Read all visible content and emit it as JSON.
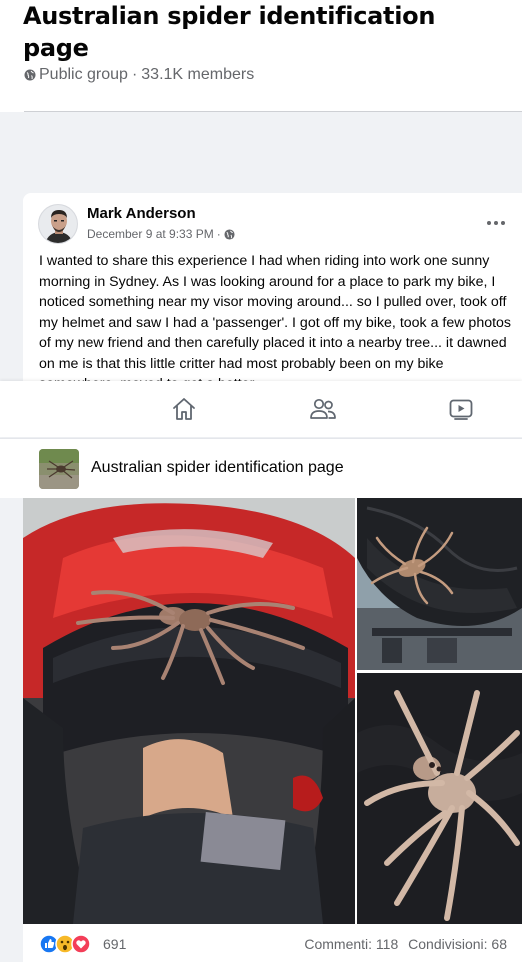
{
  "group": {
    "title": "Australian spider identification page",
    "privacy": "Public group",
    "separator": "·",
    "members": "33.1K members"
  },
  "post": {
    "author": "Mark Anderson",
    "date": "December 9 at 9:33 PM",
    "date_separator": "·",
    "text": "I wanted to share this experience I had when riding into work one sunny morning in Sydney. As I was looking around for a place to park my bike, I noticed something near my visor moving around... so I pulled over, took off my helmet and saw I had a 'passenger'. I got off my bike, took a few photos of my new friend and then carefully placed it into a nearby tree... it  dawned on me is that this little critter had most probably been on my bike somewhere, moved to get a better"
  },
  "tabs": [
    "home-icon",
    "groups-icon",
    "watch-icon"
  ],
  "shared": {
    "name": "Australian spider identification page"
  },
  "reactions": {
    "count": "691",
    "icons": [
      "like-icon",
      "wow-icon",
      "love-icon"
    ]
  },
  "stats": {
    "comments": "Commenti: 118",
    "shares": "Condivisioni: 68"
  },
  "colors": {
    "like": "#1877f2",
    "wow": "#f7b928",
    "love": "#f33e58",
    "secondary_text": "#65676b"
  }
}
